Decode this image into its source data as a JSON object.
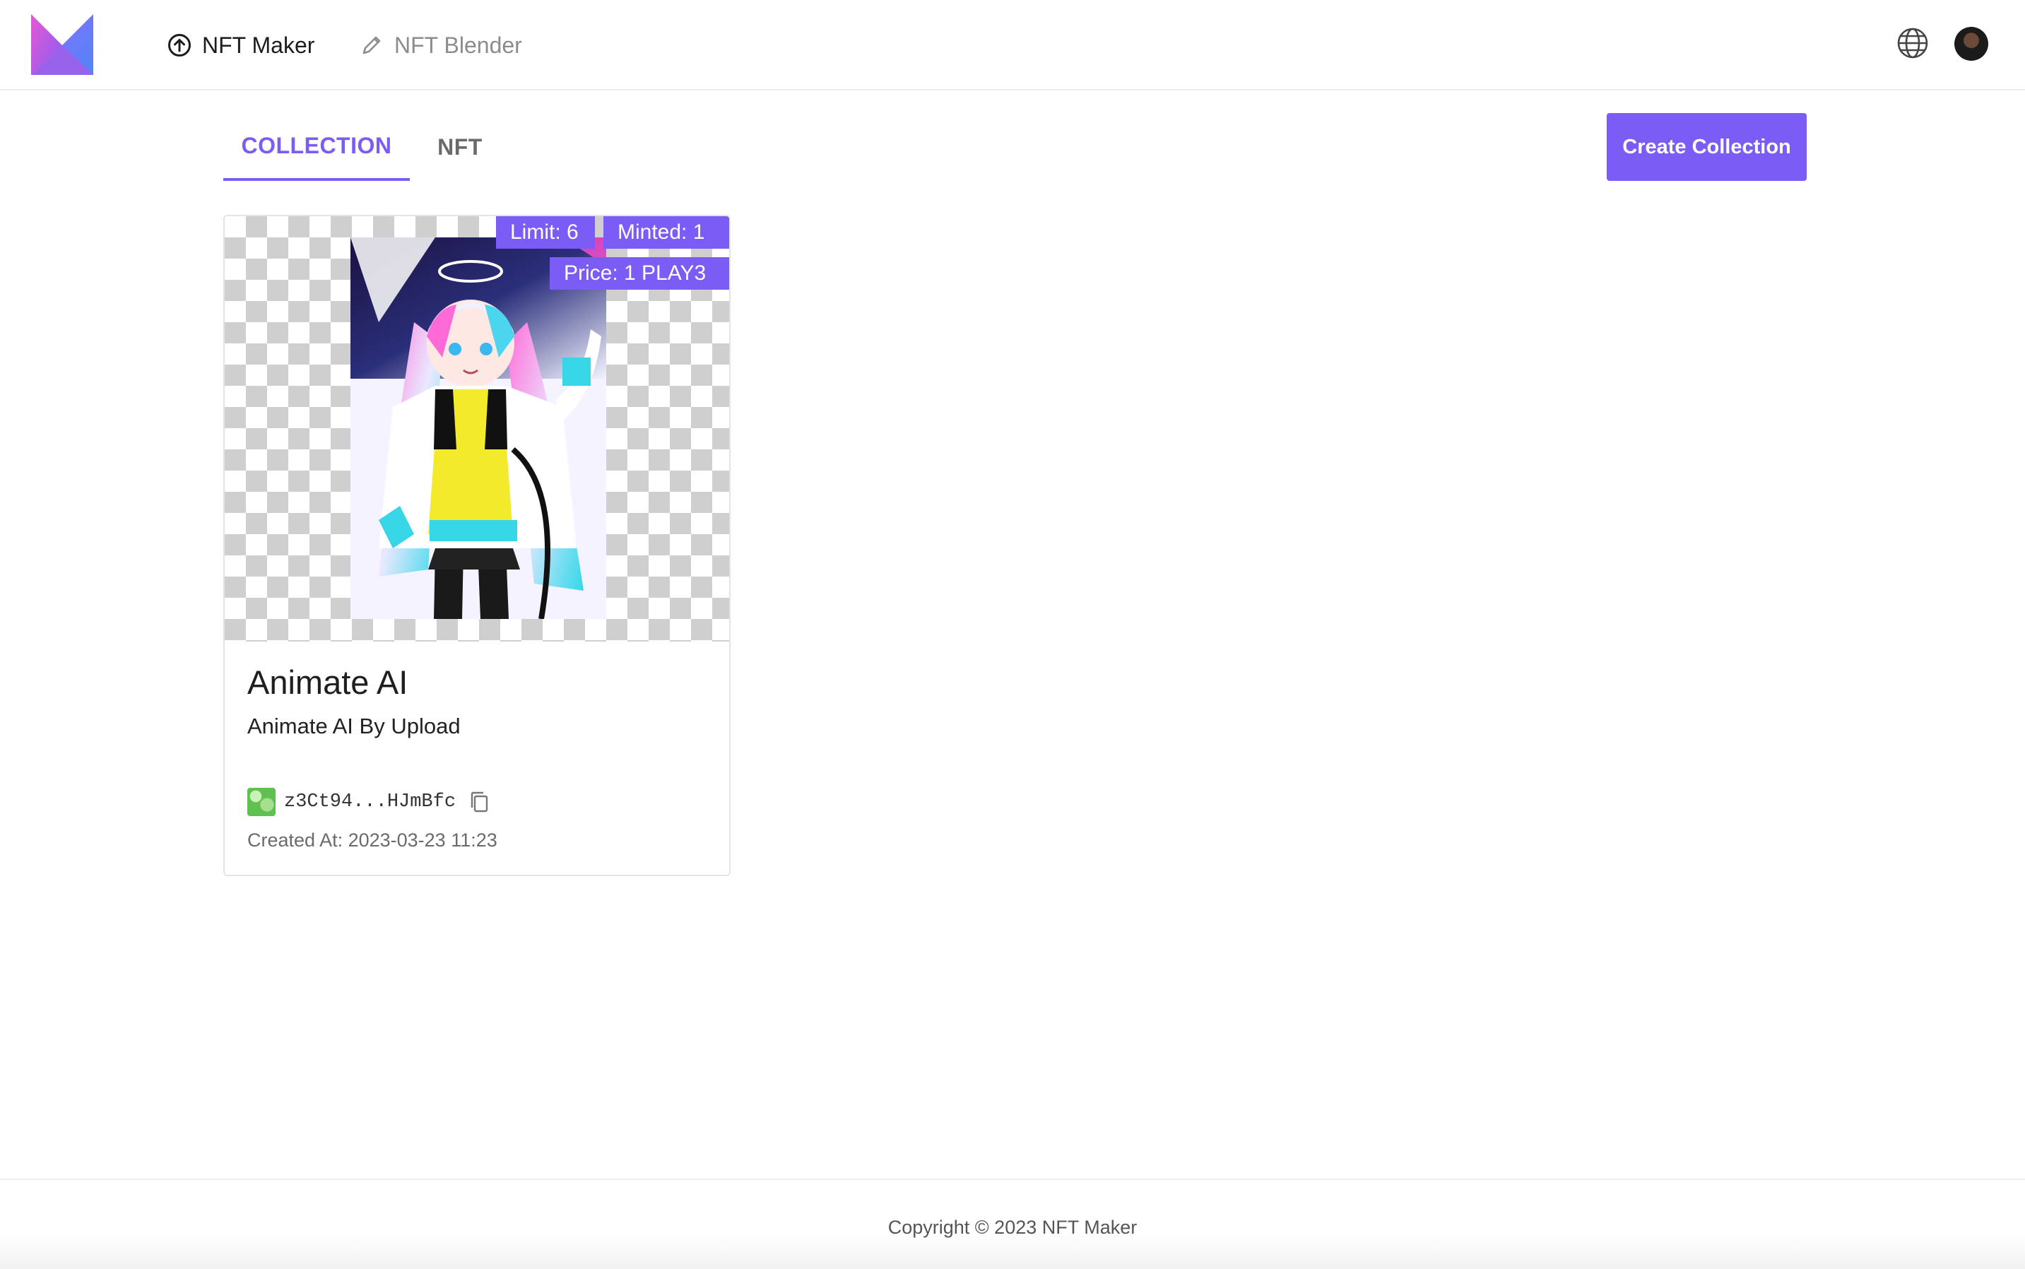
{
  "nav": {
    "items": [
      {
        "label": "NFT Maker",
        "icon": "upload-circle-icon",
        "active": true
      },
      {
        "label": "NFT Blender",
        "icon": "pencil-icon",
        "active": false
      }
    ],
    "right_icons": [
      "globe-icon",
      "user-avatar"
    ]
  },
  "tabs": [
    {
      "label": "COLLECTION",
      "active": true
    },
    {
      "label": "NFT",
      "active": false
    }
  ],
  "actions": {
    "create_collection": "Create Collection"
  },
  "collections": [
    {
      "limit": "Limit: 6",
      "minted": "Minted: 1",
      "price": "Price: 1 PLAY3",
      "title": "Animate AI",
      "subtitle": "Animate AI By Upload",
      "address": "z3Ct94...HJmBfc",
      "created_at": "Created At: 2023-03-23 11:23"
    }
  ],
  "footer": {
    "copyright": "Copyright © 2023 NFT Maker"
  },
  "colors": {
    "accent": "#7b5cf5",
    "nav_inactive": "#8c8c8c",
    "border": "#e4e4e4"
  }
}
